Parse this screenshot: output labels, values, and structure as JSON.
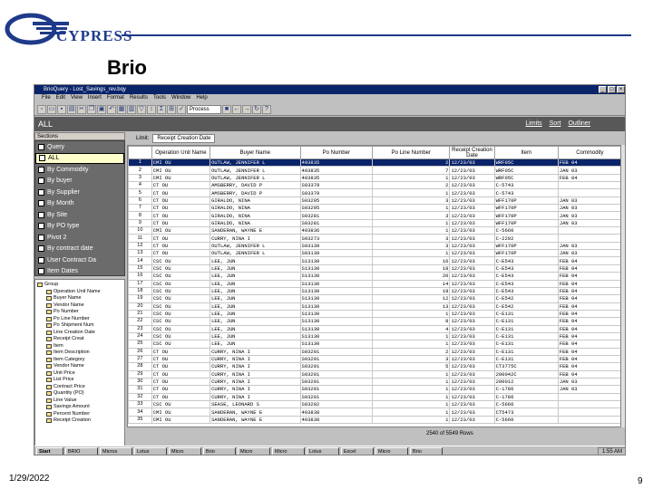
{
  "slide": {
    "logo_text": "CYPRESS",
    "title": "Brio",
    "date": "1/29/2022",
    "page_number": "9"
  },
  "window": {
    "title": "BrioQuery - Lost_Savings_rev.bqy",
    "menu": [
      "File",
      "Edit",
      "View",
      "Insert",
      "Format",
      "Results",
      "Tools",
      "Window",
      "Help"
    ],
    "process_label": "Process",
    "path_label": "ALL",
    "links": [
      "Limits",
      "Sort",
      "Outliner"
    ]
  },
  "sections": {
    "header": "Sections",
    "items": [
      {
        "label": "Query",
        "selected": false
      },
      {
        "label": "ALL",
        "selected": true
      },
      {
        "label": "By Commodity",
        "selected": false
      },
      {
        "label": "By buyer",
        "selected": false
      },
      {
        "label": "By Supplier",
        "selected": false
      },
      {
        "label": "By Month",
        "selected": false
      },
      {
        "label": "By Site",
        "selected": false
      },
      {
        "label": "By PO type",
        "selected": false
      },
      {
        "label": "Pivot 2",
        "selected": false
      },
      {
        "label": "By contract date",
        "selected": false
      },
      {
        "label": "User Contract Da",
        "selected": false
      },
      {
        "label": "Item Dates",
        "selected": false
      }
    ]
  },
  "tree": {
    "root": "Group",
    "items": [
      "Operation Unit Name",
      "Buyer Name",
      "Vendor Name",
      "Po Number",
      "Po Line Number",
      "Po Shipment Num",
      "Line Creation Date",
      "Receipt Creat",
      "Item",
      "Item Description",
      "Item Category",
      "Vendor Name",
      "Unit Price",
      "List Price",
      "Contract Price",
      "Quantity (PO)",
      "Line Value",
      "Savings Amount",
      "Percent Number",
      "Receipt Creation"
    ]
  },
  "grid": {
    "limit_label": "Limit:",
    "limit_tab": "Receipt Creation Date",
    "columns": [
      "Operation Unit Name",
      "Buyer Name",
      "Po Number",
      "Po Line Number",
      "Receipt Creation Date",
      "Item",
      "Commodity"
    ],
    "rows": [
      [
        "CMI OU",
        "OUTLAW, JENNIFER L",
        "403835",
        "2",
        "12/23/03",
        "WRF05C",
        "FEB 04"
      ],
      [
        "CMI OU",
        "OUTLAW, JENNIFER L",
        "403835",
        "7",
        "12/23/03",
        "WRF05C",
        "JAN 03"
      ],
      [
        "CMI OU",
        "OUTLAW, JENNIFER L",
        "403835",
        "1",
        "12/23/03",
        "WRF05C",
        "FEB 04"
      ],
      [
        "CT OU",
        "AMSBERRY, DAVID P",
        "S03379",
        "2",
        "12/23/03",
        "C-5743",
        ""
      ],
      [
        "CT OU",
        "AMSBERRY, DAVID P",
        "S03379",
        "1",
        "12/23/03",
        "C-5743",
        ""
      ],
      [
        "CT OU",
        "GIRALDO, NINA",
        "S03295",
        "3",
        "12/23/03",
        "WFF170P",
        "JAN 03"
      ],
      [
        "CT OU",
        "GIRALDO, NINA",
        "S03295",
        "1",
        "12/23/03",
        "WFF170P",
        "JAN 03"
      ],
      [
        "CT OU",
        "GIRALDO, NINA",
        "S03281",
        "3",
        "12/23/03",
        "WFF170P",
        "JAN 03"
      ],
      [
        "CT OU",
        "GIRALDO, NINA",
        "S03281",
        "1",
        "12/23/03",
        "WFF170P",
        "JAN 03"
      ],
      [
        "CMI OU",
        "SANDERAN, WAYNE E",
        "403836",
        "1",
        "12/23/03",
        "C-5660",
        ""
      ],
      [
        "CT OU",
        "CURRY, NINA I",
        "S03273",
        "3",
        "12/23/03",
        "C-2202",
        ""
      ],
      [
        "CT OU",
        "OUTLAW, JENNIFER L",
        "S03139",
        "3",
        "12/23/03",
        "WFF170P",
        "JAN 03"
      ],
      [
        "CT OU",
        "OUTLAW, JENNIFER L",
        "S03139",
        "1",
        "12/23/03",
        "WFF170P",
        "JAN 03"
      ],
      [
        "CSC OU",
        "LEE, JUN",
        "S13130",
        "16",
        "12/23/03",
        "C-E543",
        "FEB 04"
      ],
      [
        "CSC OU",
        "LEE, JUN",
        "S13130",
        "18",
        "12/23/03",
        "C-E543",
        "FEB 04"
      ],
      [
        "CSC OU",
        "LEE, JUN",
        "S13130",
        "20",
        "12/23/03",
        "C-E543",
        "FEB 04"
      ],
      [
        "CSC OU",
        "LEE, JUN",
        "S13130",
        "14",
        "12/23/03",
        "C-E543",
        "FEB 04"
      ],
      [
        "CSC OU",
        "LEE, JUN",
        "S13130",
        "19",
        "12/23/03",
        "C-E543",
        "FEB 04"
      ],
      [
        "CSC OU",
        "LEE, JUN",
        "S13130",
        "12",
        "12/23/03",
        "C-E542",
        "FEB 04"
      ],
      [
        "CSC OU",
        "LEE, JUN",
        "S13130",
        "13",
        "12/23/03",
        "C-E542",
        "FEB 04"
      ],
      [
        "CSC OU",
        "LEE, JUN",
        "S13130",
        "1",
        "12/23/03",
        "C-E131",
        "FEB 04"
      ],
      [
        "CSC OU",
        "LEE, JUN",
        "S13130",
        "8",
        "12/23/03",
        "C-E131",
        "FEB 04"
      ],
      [
        "CSC OU",
        "LEE, JUN",
        "S13130",
        "4",
        "12/23/03",
        "C-E131",
        "FEB 04"
      ],
      [
        "CSC OU",
        "LEE, JUN",
        "S13130",
        "1",
        "12/23/03",
        "C-E131",
        "FEB 04"
      ],
      [
        "CSC OU",
        "LEE, JUN",
        "S13130",
        "1",
        "12/23/03",
        "C-E131",
        "FEB 04"
      ],
      [
        "CT OU",
        "CURRY, NINA I",
        "S03201",
        "2",
        "12/23/03",
        "C-E131",
        "FEB 04"
      ],
      [
        "CT OU",
        "CURRY, NINA I",
        "S03201",
        "3",
        "12/23/03",
        "C-E131",
        "FEB 04"
      ],
      [
        "CT OU",
        "CURRY, NINA I",
        "S03201",
        "5",
        "12/23/03",
        "CT3775C",
        "FEB 04"
      ],
      [
        "CT OU",
        "CURRY, NINA I",
        "S03201",
        "1",
        "12/23/03",
        "200042C",
        "FEB 04"
      ],
      [
        "CT OU",
        "CURRY, NINA I",
        "S03201",
        "1",
        "12/23/03",
        "200012",
        "JAN 03"
      ],
      [
        "CT OU",
        "CURRY, NINA I",
        "S03201",
        "1",
        "12/23/03",
        "C-1786",
        "JAN 03"
      ],
      [
        "CT OU",
        "CURRY, NINA I",
        "S03201",
        "1",
        "12/23/03",
        "C-1786",
        ""
      ],
      [
        "CSC OU",
        "SEASE, LEONARD S",
        "S03202",
        "1",
        "12/23/03",
        "C-5660",
        ""
      ],
      [
        "CMI OU",
        "SANDERAN, WAYNE E",
        "403838",
        "1",
        "12/23/03",
        "CT5473",
        ""
      ],
      [
        "CMI OU",
        "SANDERAN, WAYNE E",
        "403838",
        "1",
        "12/23/03",
        "C-5660",
        ""
      ]
    ],
    "status": "2540 of 5549 Rows"
  },
  "taskbar": {
    "start": "Start",
    "items": [
      "BRIO",
      "Micros",
      "Lotus",
      "Micro",
      "Brio",
      "Micro",
      "Micro",
      "Lotus",
      "Excel",
      "Micro",
      "Brio"
    ],
    "clock": "1:55 AM"
  }
}
